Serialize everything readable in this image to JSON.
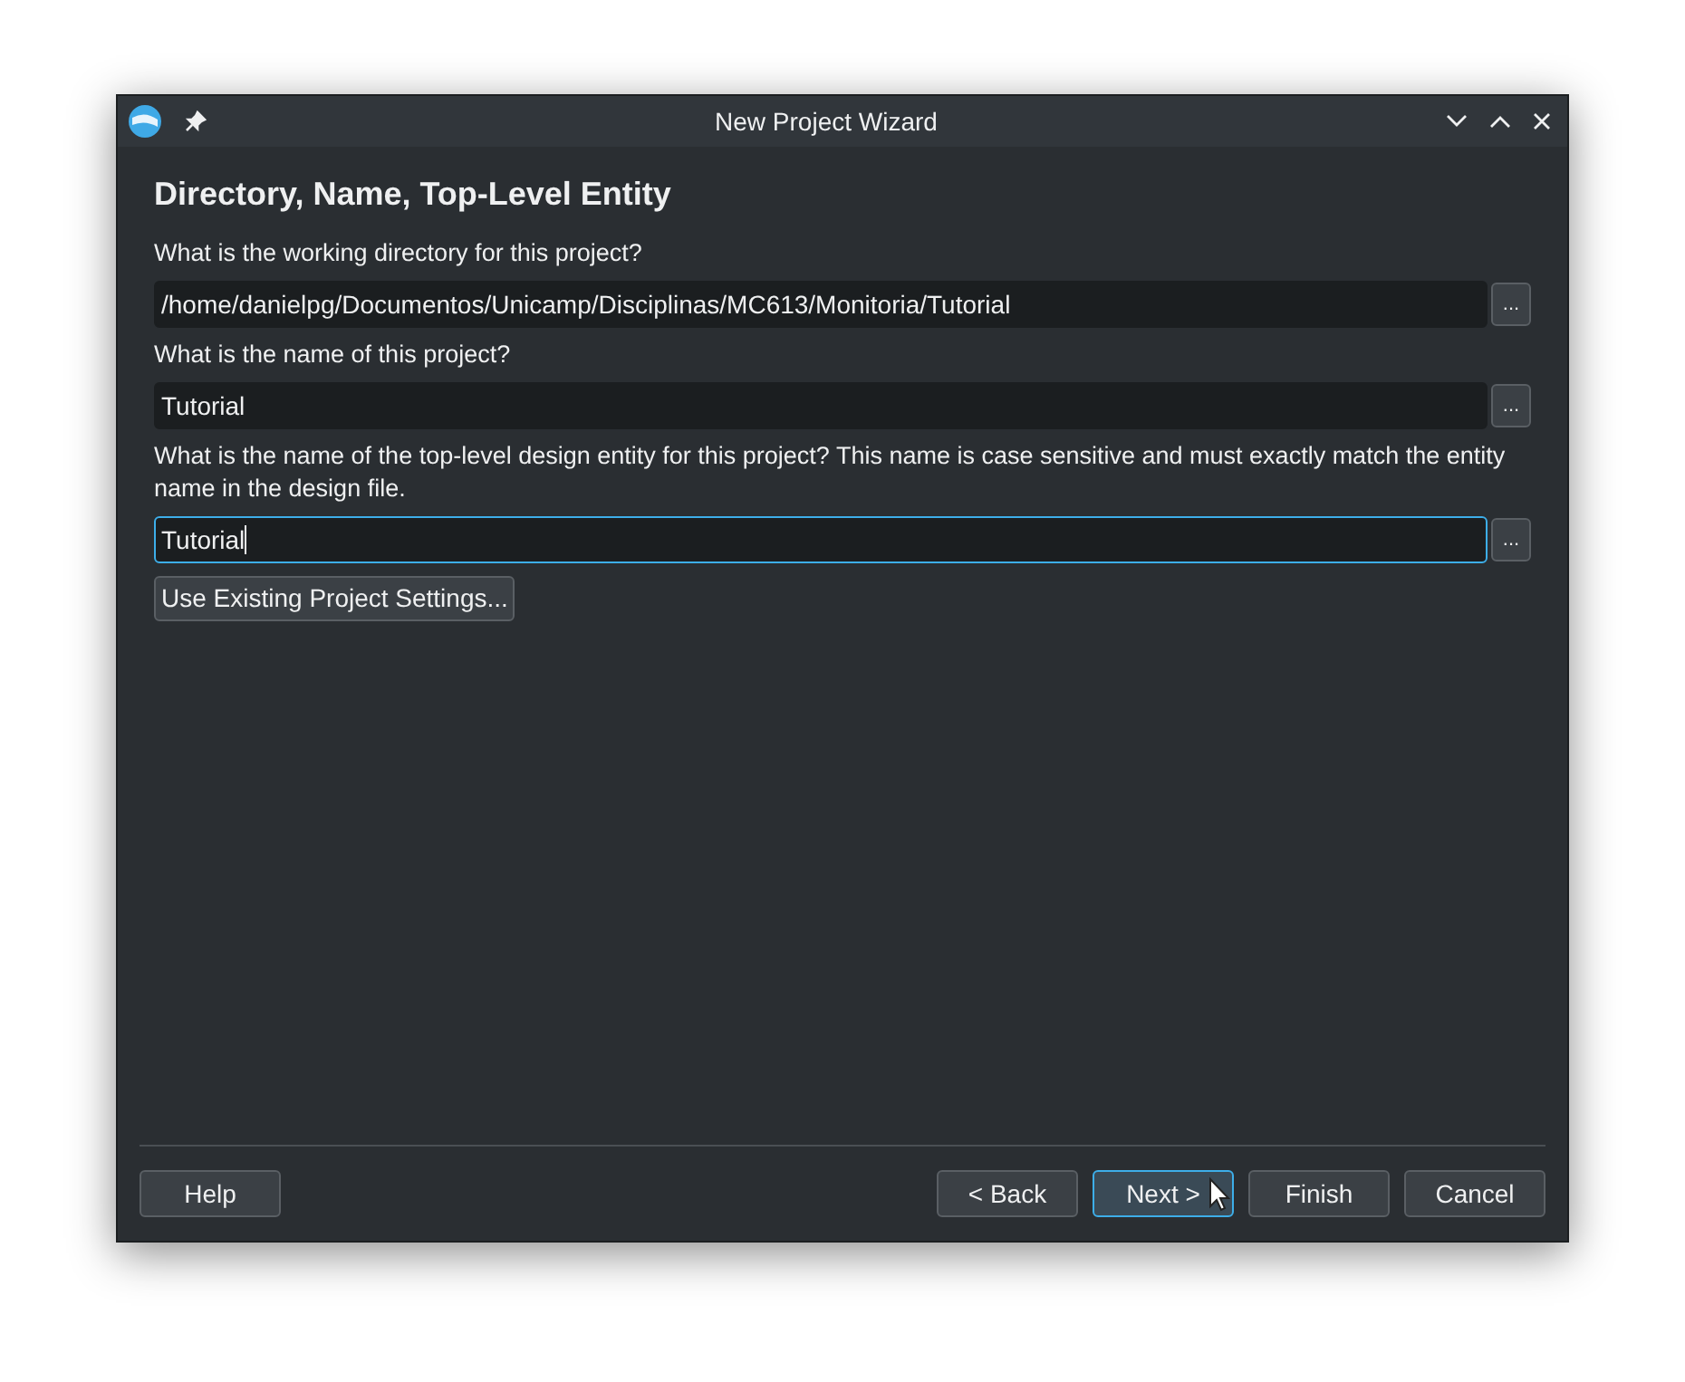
{
  "window": {
    "title": "New Project Wizard"
  },
  "heading": "Directory, Name, Top-Level Entity",
  "fields": [
    {
      "label": "What is the working directory for this project?",
      "value": "/home/danielpg/Documentos/Unicamp/Disciplinas/MC613/Monitoria/Tutorial",
      "browse": "...",
      "focused": false
    },
    {
      "label": "What is the name of this project?",
      "value": "Tutorial",
      "browse": "...",
      "focused": false
    },
    {
      "label": "What is the name of the top-level design entity for this project? This name is case sensitive and must exactly match the entity name in the design file.",
      "value": "Tutorial",
      "browse": "...",
      "focused": true
    }
  ],
  "settings_button": "Use Existing Project Settings...",
  "footer_left": [
    {
      "label": "Help",
      "focused": false
    }
  ],
  "footer_right": [
    {
      "label": "< Back",
      "focused": false
    },
    {
      "label": "Next >",
      "focused": true
    },
    {
      "label": "Finish",
      "focused": false
    },
    {
      "label": "Cancel",
      "focused": false
    }
  ]
}
